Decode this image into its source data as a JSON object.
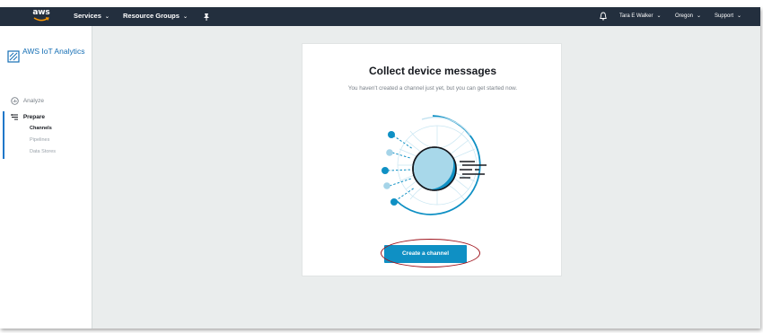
{
  "topnav": {
    "logo_text": "aws",
    "services_label": "Services",
    "resource_groups_label": "Resource Groups",
    "pin_icon": "pin-icon",
    "bell_icon": "bell-icon",
    "user_label": "Tara E Walker",
    "region_label": "Oregon",
    "support_label": "Support",
    "caret": "⌄",
    "background": "#232f3e"
  },
  "sidebar": {
    "brand_title": "AWS IoT Analytics",
    "brand_icon": "iot-analytics-icon",
    "analyze_label": "Analyze",
    "analyze_icon": "analyze-icon",
    "prepare_label": "Prepare",
    "prepare_icon": "prepare-icon",
    "items": [
      {
        "label": "Channels"
      },
      {
        "label": "Pipelines"
      },
      {
        "label": "Data Stores"
      }
    ],
    "accent": "#146eb4"
  },
  "main": {
    "title": "Collect device messages",
    "subtitle": "You haven't created a channel just yet, but you can get started now.",
    "create_button_label": "Create a channel",
    "button_color": "#0f90c4",
    "highlight_color": "#a0151e",
    "illustration_icon": "channel-illustration-icon"
  }
}
